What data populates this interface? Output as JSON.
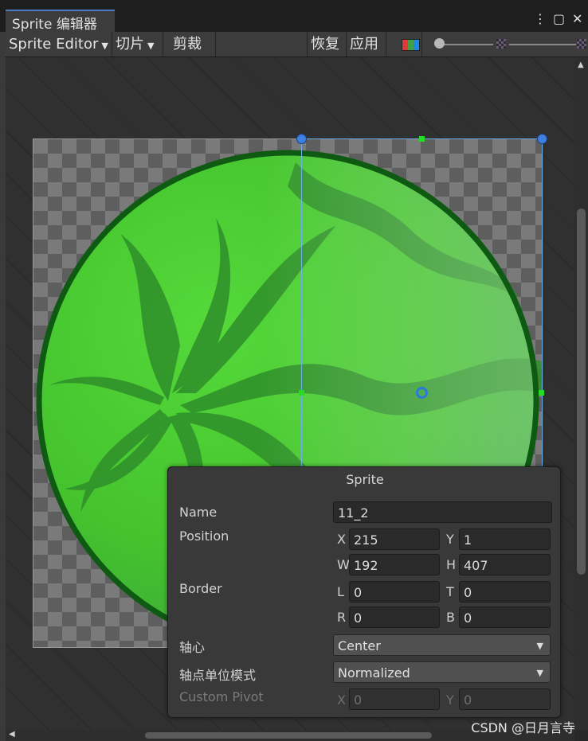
{
  "window": {
    "tab_title": "Sprite 编辑器",
    "kebab_icon": "⋮",
    "maximize_icon": "▢",
    "close_icon": "✕"
  },
  "toolbar": {
    "editor_mode": "Sprite Editor",
    "slice": "切片",
    "trim": "剪裁",
    "revert": "恢复",
    "apply": "应用"
  },
  "sprite_panel": {
    "title": "Sprite",
    "name_label": "Name",
    "name_value": "11_2",
    "position_label": "Position",
    "x_label": "X",
    "x_value": "215",
    "y_label": "Y",
    "y_value": "1",
    "w_label": "W",
    "w_value": "192",
    "h_label": "H",
    "h_value": "407",
    "border_label": "Border",
    "l_label": "L",
    "l_value": "0",
    "t_label": "T",
    "t_value": "0",
    "r_label": "R",
    "r_value": "0",
    "b_label": "B",
    "b_value": "0",
    "pivot_label": "轴心",
    "pivot_value": "Center",
    "pivot_unit_label": "轴点单位模式",
    "pivot_unit_value": "Normalized",
    "custom_pivot_label": "Custom Pivot",
    "cp_x_label": "X",
    "cp_x_value": "0",
    "cp_y_label": "Y",
    "cp_y_value": "0"
  },
  "watermark": "CSDN @日月言寺",
  "colors": {
    "accent": "#3f7fe0",
    "handle_green": "#22dd22",
    "melon_light": "#4ccd32",
    "melon_dark": "#2e8f2a",
    "melon_rim": "#0f5a12"
  }
}
